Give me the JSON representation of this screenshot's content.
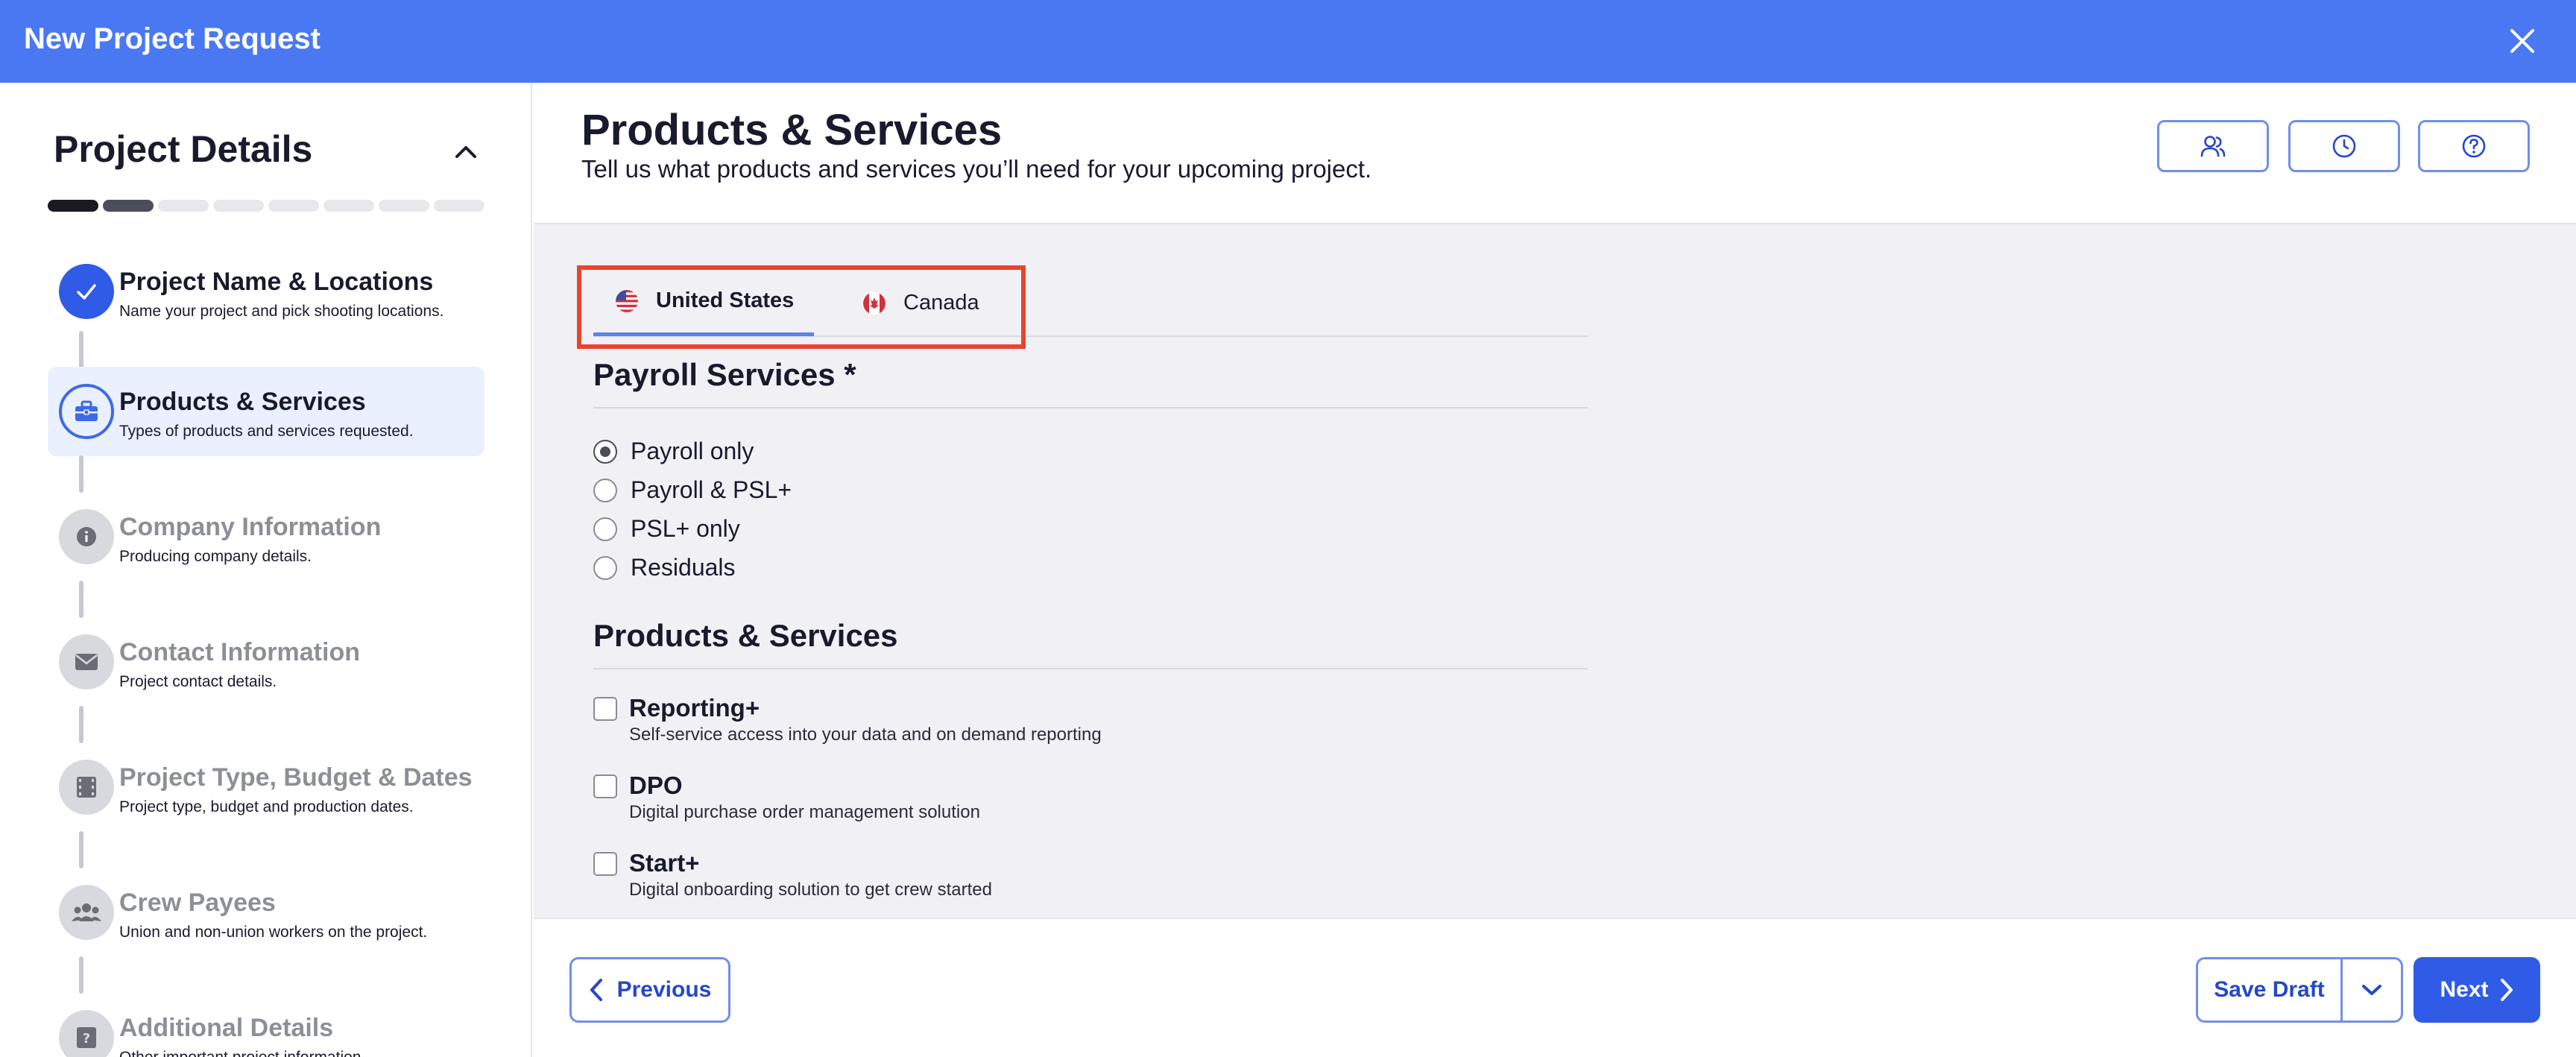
{
  "window": {
    "title": "New Project Request",
    "close_icon": "close-icon"
  },
  "sidebar": {
    "title": "Project Details",
    "progress": {
      "total_steps": 8,
      "completed": 1,
      "current": 2
    },
    "steps": [
      {
        "label": "Project Name & Locations",
        "description": "Name your project and pick shooting locations.",
        "state": "done",
        "icon": "check-icon"
      },
      {
        "label": "Products & Services",
        "description": "Types of products and services requested.",
        "state": "active",
        "icon": "briefcase-icon"
      },
      {
        "label": "Company Information",
        "description": "Producing company details.",
        "state": "todo",
        "icon": "info-icon"
      },
      {
        "label": "Contact Information",
        "description": "Project contact details.",
        "state": "todo",
        "icon": "envelope-icon"
      },
      {
        "label": "Project Type, Budget & Dates",
        "description": "Project type, budget and production dates.",
        "state": "todo",
        "icon": "film-icon"
      },
      {
        "label": "Crew Payees",
        "description": "Union and non-union workers on the project.",
        "state": "todo",
        "icon": "users-icon"
      },
      {
        "label": "Additional Details",
        "description": "Other important project information.",
        "state": "todo",
        "icon": "question-icon"
      }
    ]
  },
  "main": {
    "title": "Products & Services",
    "subtitle": "Tell us what products and services you’ll need for your upcoming project.",
    "header_buttons": [
      "users-icon",
      "clock-icon",
      "help-icon"
    ],
    "tabs": [
      {
        "label": "United States",
        "flag": "us-flag-icon",
        "selected": true
      },
      {
        "label": "Canada",
        "flag": "canada-flag-icon",
        "selected": false
      }
    ],
    "payroll": {
      "title": "Payroll Services *",
      "options": [
        {
          "label": "Payroll only",
          "checked": true
        },
        {
          "label": "Payroll & PSL+",
          "checked": false
        },
        {
          "label": "PSL+ only",
          "checked": false
        },
        {
          "label": "Residuals",
          "checked": false
        }
      ]
    },
    "products": {
      "title": "Products & Services",
      "items": [
        {
          "label": "Reporting+",
          "description": "Self-service access into your data and on demand reporting",
          "checked": false
        },
        {
          "label": "DPO",
          "description": "Digital purchase order management solution",
          "checked": false
        },
        {
          "label": "Start+",
          "description": "Digital onboarding solution to get crew started",
          "checked": false
        }
      ]
    }
  },
  "footer": {
    "previous_label": "Previous",
    "save_label": "Save Draft",
    "next_label": "Next"
  },
  "colors": {
    "brand": "#4a78f3",
    "primary": "#2f5be6",
    "highlight": "#e8432d"
  }
}
